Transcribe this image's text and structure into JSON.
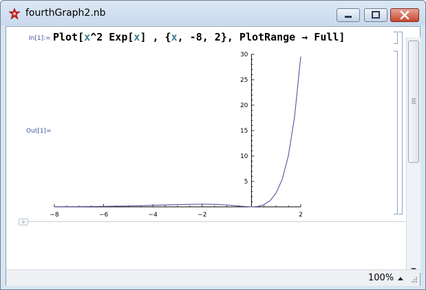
{
  "window": {
    "title": "fourthGraph2.nb",
    "controls": [
      "minimize",
      "maximize",
      "close"
    ]
  },
  "notebook": {
    "input_label": "In[1]:=",
    "output_label": "Out[1]=",
    "input_tokens": {
      "plot": "Plot[",
      "x1": "x",
      "pow": "^2 Exp[",
      "x2": "x",
      "mid": "] , {",
      "x3": "x",
      "rest": ", -8, 2}, PlotRange → Full]"
    }
  },
  "status": {
    "zoom": "100%"
  },
  "colors": {
    "curve": "#5252a3",
    "label_blue": "#3e56a8",
    "var_teal": "#3b7f8f"
  },
  "chart_data": {
    "type": "line",
    "function": "x^2 Exp[x]",
    "x_range": [
      -8,
      2
    ],
    "y_range": [
      0,
      30
    ],
    "x_ticks": [
      -8,
      -6,
      -4,
      -2,
      2
    ],
    "y_ticks": [
      5,
      10,
      15,
      20,
      25,
      30
    ],
    "series": [
      {
        "x": [
          -8,
          -7,
          -6,
          -5,
          -4,
          -3,
          -2,
          -1.5,
          -1,
          -0.5,
          0,
          0.25,
          0.5,
          0.75,
          1,
          1.25,
          1.5,
          1.75,
          2
        ],
        "y": [
          0.02,
          0.04,
          0.09,
          0.17,
          0.29,
          0.45,
          0.54,
          0.5,
          0.37,
          0.15,
          0,
          0.08,
          0.41,
          1.19,
          2.72,
          5.45,
          10.08,
          17.72,
          29.56
        ]
      }
    ],
    "grid": false,
    "axes_origin": [
      0,
      0
    ]
  }
}
